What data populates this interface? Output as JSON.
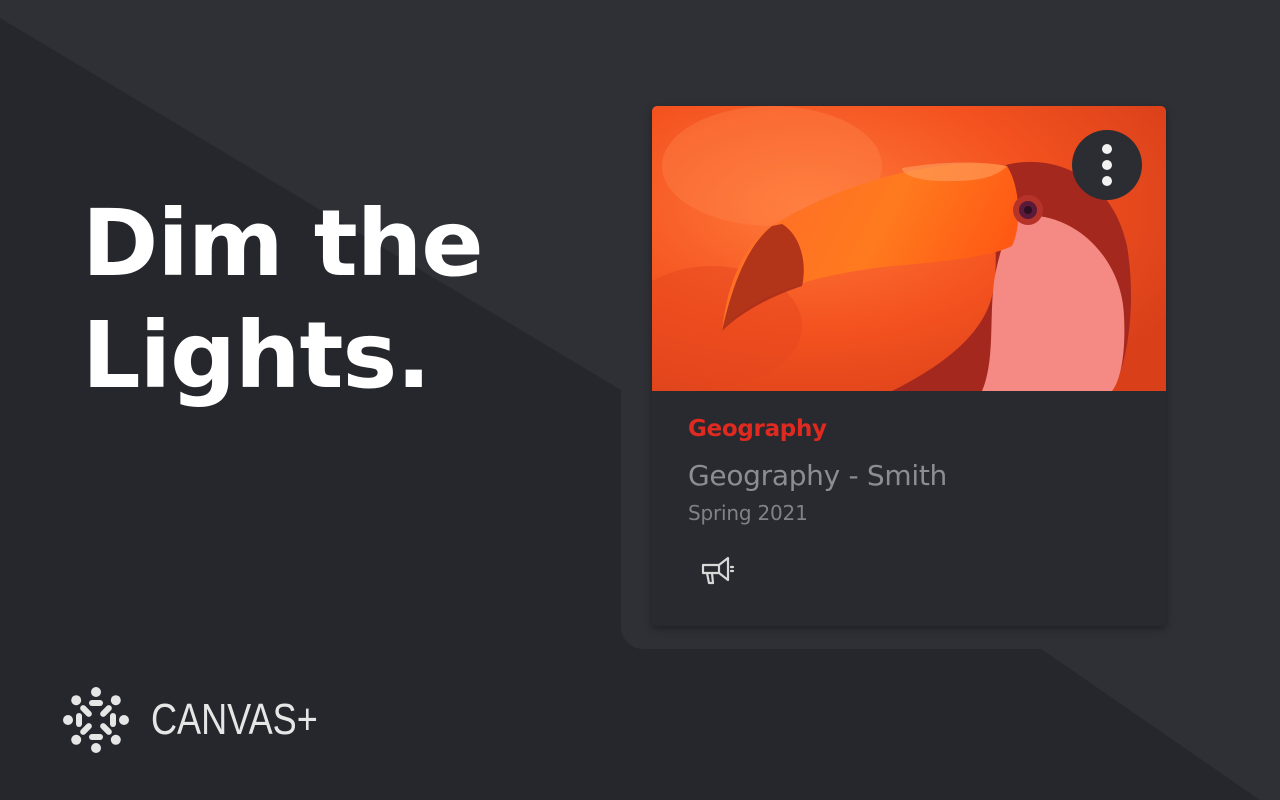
{
  "hero": {
    "line1": "Dim the",
    "line2": "Lights."
  },
  "brand": {
    "name": "CANVAS+",
    "logo_icon": "canvas-logo-icon"
  },
  "card": {
    "course_code": "Geography",
    "course_name": "Geography - Smith",
    "term": "Spring 2021",
    "menu_icon": "kebab-menu-icon",
    "action_icon": "megaphone-icon"
  },
  "colors": {
    "background": "#25272c",
    "background_light": "#2e3036",
    "card": "#282a2f",
    "accent": "#e0291f",
    "text_muted": "#8a8d93",
    "image_tint": "#ff5a1f"
  }
}
